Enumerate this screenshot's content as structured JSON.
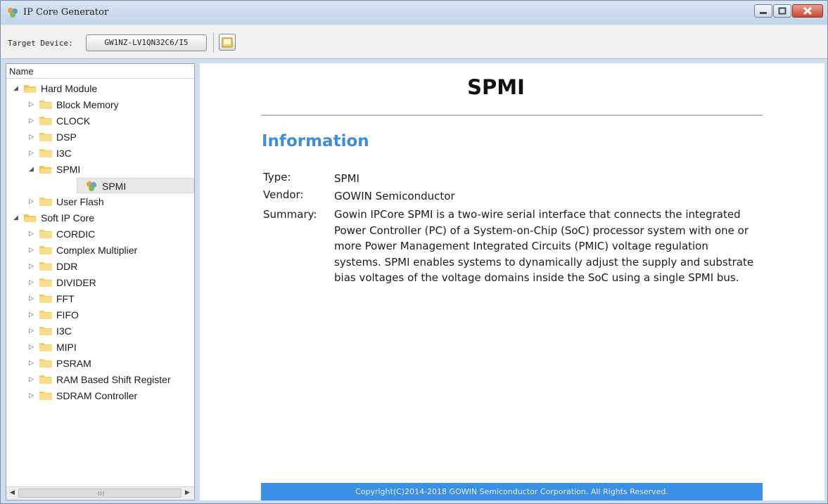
{
  "window": {
    "title": "IP Core Generator",
    "controls": {
      "minimize": "minimize",
      "maximize": "maximize",
      "close": "close"
    }
  },
  "toolbar": {
    "target_label": "Target Device:",
    "device": "GW1NZ-LV1QN32C6/I5"
  },
  "tree": {
    "header": "Name",
    "nodes": [
      {
        "label": "Hard Module",
        "icon": "folder-open-icon",
        "state": "expanded"
      },
      {
        "label": "Block Memory",
        "icon": "folder-icon",
        "state": "collapsed"
      },
      {
        "label": "CLOCK",
        "icon": "folder-icon",
        "state": "collapsed"
      },
      {
        "label": "DSP",
        "icon": "folder-icon",
        "state": "collapsed"
      },
      {
        "label": "I3C",
        "icon": "folder-icon",
        "state": "collapsed"
      },
      {
        "label": "SPMI",
        "icon": "folder-open-icon",
        "state": "expanded"
      },
      {
        "label": "SPMI",
        "icon": "ip-core-icon",
        "state": "selected"
      },
      {
        "label": "User Flash",
        "icon": "folder-icon",
        "state": "collapsed"
      },
      {
        "label": "Soft IP Core",
        "icon": "folder-open-icon",
        "state": "expanded"
      },
      {
        "label": "CORDIC",
        "icon": "folder-icon",
        "state": "collapsed"
      },
      {
        "label": "Complex Multiplier",
        "icon": "folder-icon",
        "state": "collapsed"
      },
      {
        "label": "DDR",
        "icon": "folder-icon",
        "state": "collapsed"
      },
      {
        "label": "DIVIDER",
        "icon": "folder-icon",
        "state": "collapsed"
      },
      {
        "label": "FFT",
        "icon": "folder-icon",
        "state": "collapsed"
      },
      {
        "label": "FIFO",
        "icon": "folder-icon",
        "state": "collapsed"
      },
      {
        "label": "I3C",
        "icon": "folder-icon",
        "state": "collapsed"
      },
      {
        "label": "MIPI",
        "icon": "folder-icon",
        "state": "collapsed"
      },
      {
        "label": "PSRAM",
        "icon": "folder-icon",
        "state": "collapsed"
      },
      {
        "label": "RAM Based Shift Register",
        "icon": "folder-icon",
        "state": "collapsed"
      },
      {
        "label": "SDRAM Controller",
        "icon": "folder-icon",
        "state": "collapsed"
      }
    ]
  },
  "doc": {
    "title": "SPMI",
    "section": "Information",
    "type_label": "Type:",
    "type_value": "SPMI",
    "vendor_label": "Vendor:",
    "vendor_value": "GOWIN Semiconductor",
    "summary_label": "Summary:",
    "summary_value": "Gowin IPCore SPMI is a two-wire serial interface that connects the integrated Power Controller (PC) of a System-on-Chip (SoC) processor system with one or more Power Management Integrated Circuits (PMIC) voltage regulation systems. SPMI enables systems to dynamically adjust the supply and substrate bias voltages of the voltage domains inside the SoC using a single SPMI bus.",
    "footer": "Copyright(C)2014-2018 GOWIN Semiconductor Corporation. All Rights Reserved."
  },
  "colors": {
    "accent": "#3b8fd8",
    "footer_bg": "#3a8fe6",
    "folder": "#f6d36b"
  }
}
